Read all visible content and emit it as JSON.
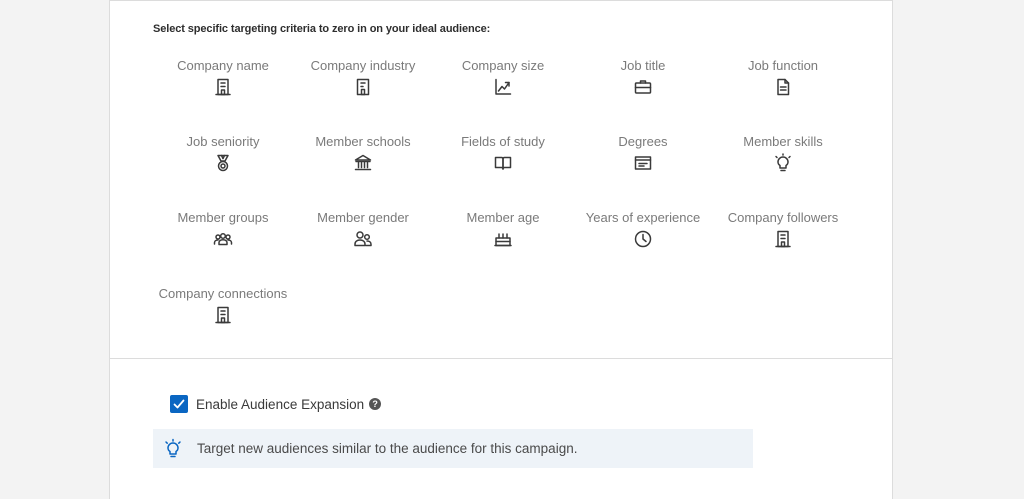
{
  "intro_text": "Select specific targeting criteria to zero in on your ideal audience:",
  "criteria": [
    {
      "label": "Company name",
      "icon": "building-icon"
    },
    {
      "label": "Company industry",
      "icon": "industry-icon"
    },
    {
      "label": "Company size",
      "icon": "growth-chart-icon"
    },
    {
      "label": "Job title",
      "icon": "briefcase-icon"
    },
    {
      "label": "Job function",
      "icon": "document-icon"
    },
    {
      "label": "Job seniority",
      "icon": "medal-icon"
    },
    {
      "label": "Member schools",
      "icon": "school-icon"
    },
    {
      "label": "Fields of study",
      "icon": "book-icon"
    },
    {
      "label": "Degrees",
      "icon": "certificate-icon"
    },
    {
      "label": "Member skills",
      "icon": "lightbulb-icon"
    },
    {
      "label": "Member groups",
      "icon": "group-icon"
    },
    {
      "label": "Member gender",
      "icon": "people-icon"
    },
    {
      "label": "Member age",
      "icon": "cake-icon"
    },
    {
      "label": "Years of experience",
      "icon": "clock-icon"
    },
    {
      "label": "Company followers",
      "icon": "building-icon"
    },
    {
      "label": "Company connections",
      "icon": "building-icon"
    }
  ],
  "expansion": {
    "label": "Enable Audience Expansion",
    "checked": true,
    "help_glyph": "?"
  },
  "tip": {
    "text": "Target new audiences similar to the audience for this campaign.",
    "icon": "lightbulb-icon"
  },
  "colors": {
    "accent": "#0a66c2",
    "tip_background": "#eef3f8"
  }
}
